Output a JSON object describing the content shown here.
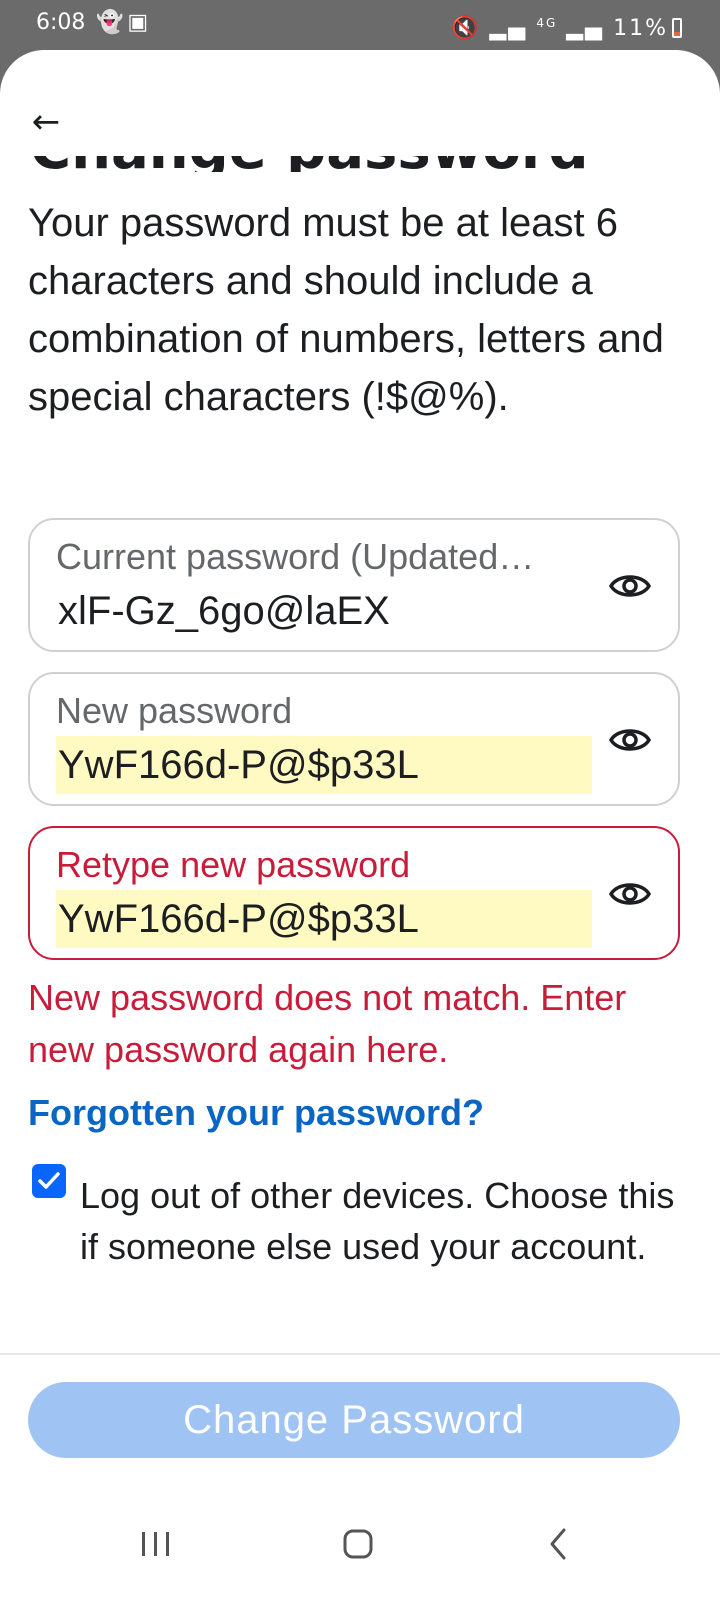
{
  "status_bar": {
    "time": "6:08",
    "notification_icons": [
      "snapchat-icon",
      "gallery-icon"
    ],
    "network": "4G",
    "battery": "11%"
  },
  "screen": {
    "title": "Change password",
    "instructions": "Your password must be at least 6 characters and should include a combination of numbers, letters and special characters (!$@%)."
  },
  "fields": [
    {
      "label": "Current password (Updated…",
      "value": "xlF-Gz_6go@laEX",
      "state": "normal",
      "autofilled": false
    },
    {
      "label": "New password",
      "value": "YwF166d-P@$p33L",
      "state": "normal",
      "autofilled": true
    },
    {
      "label": "Retype new password",
      "value": "YwF166d-P@$p33L",
      "state": "error",
      "autofilled": true
    }
  ],
  "error_message": "New password does not match. Enter new password again here.",
  "forgot_link": "Forgotten your password?",
  "logout_option": {
    "checked": true,
    "label": "Log out of other devices. Choose this if someone else used your account."
  },
  "primary_button": "Change Password",
  "colors": {
    "error": "#c91c3a",
    "link": "#0a66c2",
    "button_disabled": "#9fc3f3",
    "checkbox": "#0866ff",
    "autofill_highlight": "#fffac2"
  }
}
